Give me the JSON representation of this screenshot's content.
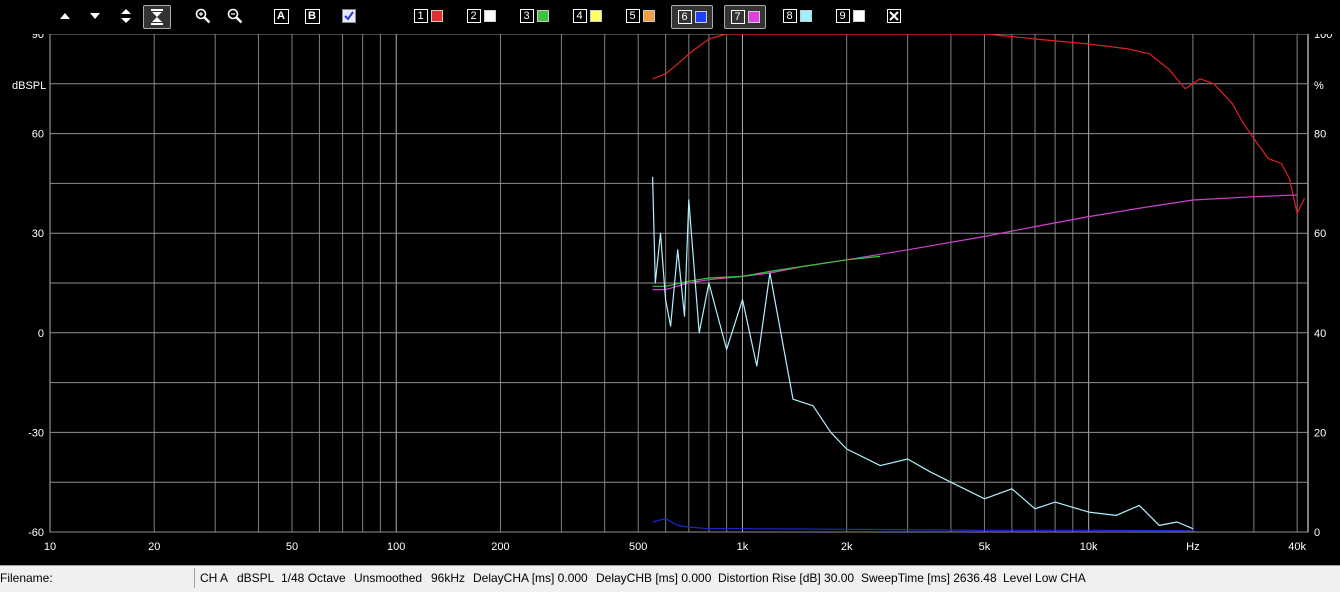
{
  "toolbar": {
    "nav_icons": [
      "arrow-up-icon",
      "arrow-down-icon",
      "expand-vertical-icon",
      "compress-vertical-icon"
    ],
    "zoom_icons": [
      "zoom-in-icon",
      "zoom-out-icon"
    ],
    "letter_buttons": [
      "A",
      "B"
    ],
    "channels": [
      {
        "num": "1",
        "color": "#e03030"
      },
      {
        "num": "2",
        "color": "#ffffff"
      },
      {
        "num": "3",
        "color": "#40c040"
      },
      {
        "num": "4",
        "color": "#ffff60"
      },
      {
        "num": "5",
        "color": "#f0a040"
      },
      {
        "num": "6",
        "color": "#2040ff"
      },
      {
        "num": "7",
        "color": "#e040e0"
      },
      {
        "num": "8",
        "color": "#a0f0ff"
      },
      {
        "num": "9",
        "color": "#ffffff"
      }
    ],
    "close_icon": "close-icon"
  },
  "status": {
    "filename_label": "Filename:",
    "channel": "CH A",
    "unit": "dBSPL",
    "octave": "1/48 Octave",
    "smoothing": "Unsmoothed",
    "rate": "96kHz",
    "delay_a": "DelayCHA [ms] 0.000",
    "delay_b": "DelayCHB [ms] 0.000",
    "distortion": "Distortion Rise [dB] 30.00",
    "sweep": "SweepTime [ms] 2636.48",
    "level": "Level Low CHA"
  },
  "chart_data": {
    "type": "line",
    "x_scale": "log",
    "xlim": [
      10,
      43000
    ],
    "ylim_left": [
      -60,
      90
    ],
    "ylim_right": [
      0,
      100
    ],
    "ylabel_left": "dBSPL",
    "ylabel_right": "%",
    "x_tick_labels": [
      "10",
      "20",
      "50",
      "100",
      "200",
      "500",
      "1k",
      "2k",
      "5k",
      "10k",
      "Hz",
      "40k"
    ],
    "y_left_ticks": [
      "90",
      "60",
      "30",
      "0",
      "-30",
      "-60"
    ],
    "y_right_ticks": [
      "100",
      "80",
      "60",
      "40",
      "20",
      "0"
    ],
    "grid": true,
    "series": [
      {
        "color": "#e02020",
        "axis": "right",
        "x": [
          550,
          600,
          650,
          700,
          800,
          900,
          1000,
          2000,
          3000,
          5000,
          6000,
          7000,
          10000,
          13000,
          15000,
          17000,
          19000,
          21000,
          23000,
          26000,
          28000,
          30000,
          33000,
          36000,
          38000,
          40000,
          42000
        ],
        "y": [
          91,
          92,
          94,
          96,
          99,
          100,
          100,
          100,
          100,
          100,
          99.5,
          99,
          98,
          97,
          96,
          93,
          89,
          91,
          90,
          86,
          82,
          79,
          75,
          74,
          71,
          64,
          67
        ]
      },
      {
        "color": "#d040d0",
        "axis": "left",
        "x": [
          550,
          600,
          700,
          800,
          1000,
          1200,
          1500,
          2000,
          3000,
          5000,
          7000,
          10000,
          15000,
          20000,
          30000,
          40000
        ],
        "y": [
          13,
          13,
          15,
          16,
          17,
          18,
          20,
          22,
          25,
          29,
          32,
          35,
          38,
          40,
          41,
          41.5
        ]
      },
      {
        "color": "#40c040",
        "axis": "left",
        "x": [
          550,
          600,
          700,
          800,
          1000,
          1200,
          1500,
          2000,
          2500
        ],
        "y": [
          14,
          14,
          15.5,
          16.5,
          17,
          18.5,
          20,
          22,
          23
        ]
      },
      {
        "color": "#b0f0ff",
        "axis": "left",
        "x": [
          550,
          560,
          580,
          600,
          620,
          650,
          680,
          700,
          750,
          800,
          900,
          1000,
          1100,
          1200,
          1400,
          1600,
          1800,
          2000,
          2500,
          3000,
          3500,
          4000,
          5000,
          6000,
          7000,
          8000,
          10000,
          12000,
          14000,
          16000,
          18000,
          20000
        ],
        "y": [
          47,
          15,
          30,
          10,
          2,
          25,
          5,
          40,
          0,
          15,
          -5,
          10,
          -10,
          18,
          -20,
          -22,
          -30,
          -35,
          -40,
          -38,
          -42,
          -45,
          -50,
          -47,
          -53,
          -51,
          -54,
          -55,
          -52,
          -58,
          -57,
          -59
        ]
      },
      {
        "color": "#1a2ad0",
        "axis": "left",
        "x": [
          550,
          600,
          650,
          700,
          800,
          1000,
          2000,
          5000,
          10000,
          20000
        ],
        "y": [
          -57,
          -56,
          -58,
          -58.5,
          -59,
          -59,
          -59.2,
          -59.5,
          -59.5,
          -59.6
        ]
      }
    ]
  }
}
